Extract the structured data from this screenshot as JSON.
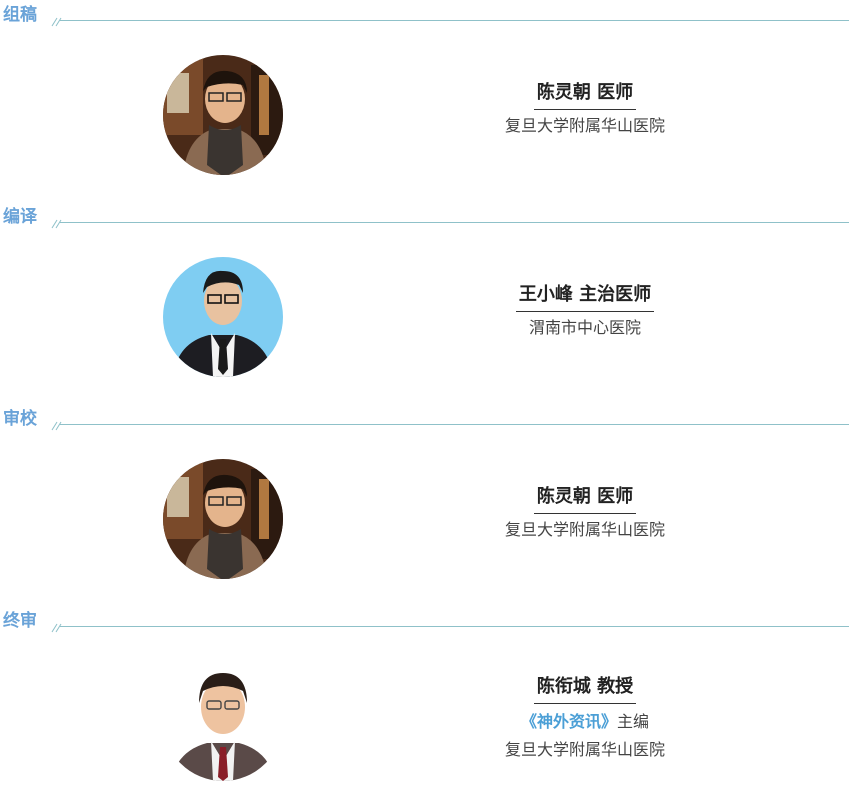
{
  "sections": [
    {
      "title": "组稿",
      "person": {
        "name": "陈灵朝 医师",
        "affiliation": "复旦大学附属华山医院",
        "avatar": "portrait-young-man-scarf"
      }
    },
    {
      "title": "编译",
      "person": {
        "name": "王小峰 主治医师",
        "affiliation": "渭南市中心医院",
        "avatar": "portrait-man-suit-blue-bg"
      }
    },
    {
      "title": "审校",
      "person": {
        "name": "陈灵朝 医师",
        "affiliation": "复旦大学附属华山医院",
        "avatar": "portrait-young-man-scarf"
      }
    },
    {
      "title": "终审",
      "person": {
        "name": "陈衔城 教授",
        "publication": "《神外资讯》",
        "role": "主编",
        "affiliation": "复旦大学附属华山医院",
        "avatar": "portrait-older-man-suit"
      }
    }
  ],
  "colors": {
    "section_title": "#6aa3d8",
    "rule": "#8fc1c9",
    "publication": "#4b9fd6"
  }
}
